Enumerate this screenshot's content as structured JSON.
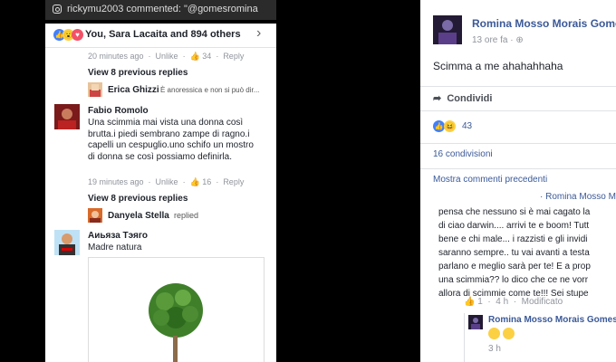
{
  "left": {
    "notification": "rickymu2003 commented: \"@gomesromina",
    "reactions_summary": "You, Sara Lacaita and 894 others",
    "comment_actions": {
      "unlike": "Unlike",
      "reply": "Reply"
    },
    "first_meta": {
      "time": "20 minutes ago",
      "likes": "34"
    },
    "view_prev_1": "View 8 previous replies",
    "reply_erica": {
      "name": "Erica Ghizzi",
      "snippet": "È anoressica e non si può dir..."
    },
    "comment_fabio": {
      "name": "Fabio Romolo",
      "text": "Una scimmia mai vista una donna così brutta.i piedi sembrano zampe di ragno.i capelli un cespuglio.uno schifo un mostro di donna se così possiamo definirla.",
      "time": "19 minutes ago",
      "likes": "16"
    },
    "view_prev_2": "View 8 previous replies",
    "reply_danyela": {
      "name": "Danyela Stella",
      "action": "replied"
    },
    "comment_aivaza": {
      "name": "Аиьяза Тэяго",
      "text": "Madre natura"
    }
  },
  "right": {
    "author": "Romina Mosso Morais Gomes",
    "time": "13 ore fa ·",
    "post_text": "Scimma a me ahahahhaha",
    "share": "Condividi",
    "reaction_count": "43",
    "shares": "16 condivisioni",
    "previous_comments": "Mostra commenti precedenti",
    "comment_author": "Romina Mosso Mo",
    "comment_lines": [
      "pensa che nessuno si è mai cagato la",
      "di ciao darwin.... arrivi te e boom! Tutt",
      "bene e chi male... i razzisti e gli invidi",
      "saranno sempre.. tu vai avanti a testa",
      "parlano e meglio sarà per te! E a prop",
      "una scimmia?? lo dico che ce ne vorr",
      "allora di scimmie come te!!! Sei stupe"
    ],
    "comment_meta": {
      "likes": "1",
      "time": "4 h",
      "edited": "Modificato"
    },
    "reply": {
      "name": "Romina Mosso Morais Gomes",
      "time": "3 h"
    }
  },
  "colors": {
    "link": "#3b5998",
    "like": "#4080ff",
    "heart": "#f25268"
  }
}
